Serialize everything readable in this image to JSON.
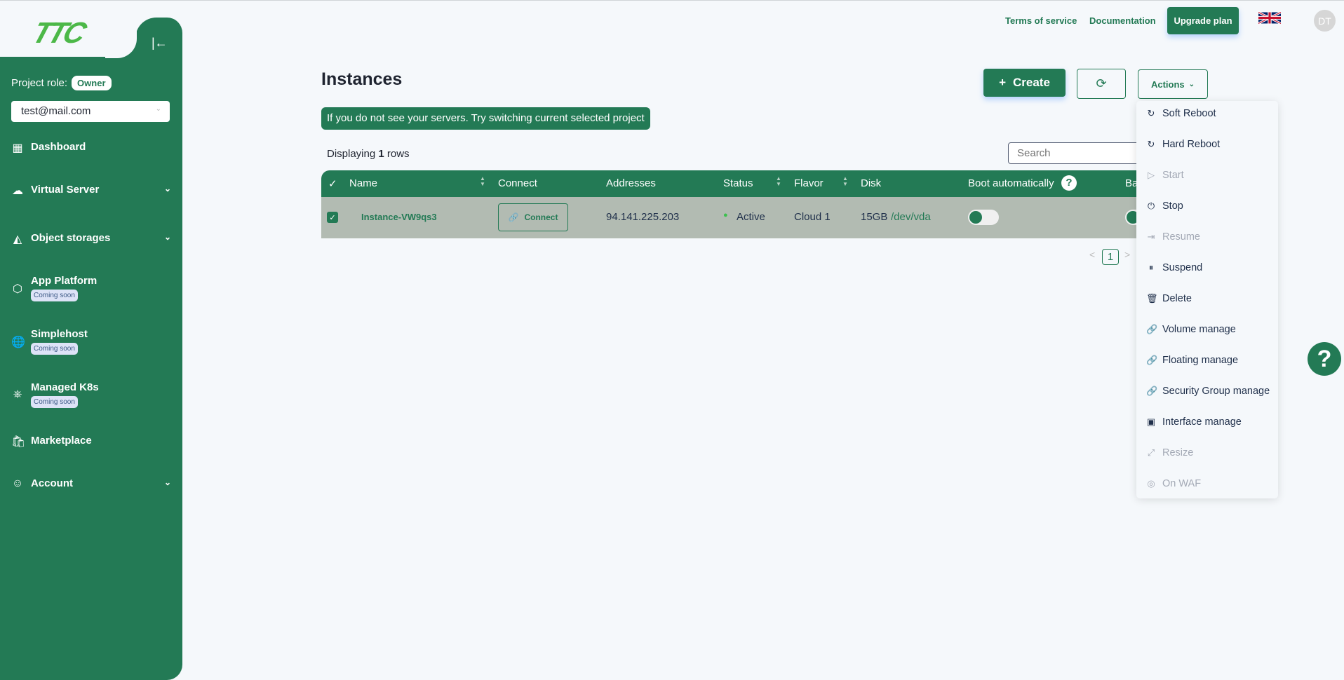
{
  "brand": {
    "logo": "TTC",
    "accent": "#237a55"
  },
  "sidebar": {
    "collapse_icon": "collapse-left-icon",
    "project_role_label": "Project role:",
    "project_role": "Owner",
    "project_select": "test@mail.com",
    "items": [
      {
        "label": "Dashboard",
        "icon": "grid-icon"
      },
      {
        "label": "Virtual Server",
        "icon": "cloud-icon",
        "expandable": true
      },
      {
        "label": "Object storages",
        "icon": "bucket-icon",
        "expandable": true
      },
      {
        "label": "App Platform",
        "icon": "cube-icon",
        "badge": "Coming soon"
      },
      {
        "label": "Simplehost",
        "icon": "globe-icon",
        "badge": "Coming soon"
      },
      {
        "label": "Managed K8s",
        "icon": "kubernetes-icon",
        "badge": "Coming soon"
      },
      {
        "label": "Marketplace",
        "icon": "bag-icon"
      },
      {
        "label": "Account",
        "icon": "user-circle-icon",
        "expandable": true
      }
    ]
  },
  "header": {
    "terms": "Terms of service",
    "docs": "Documentation",
    "upgrade": "Upgrade plan",
    "avatar": "DT",
    "language": "en-GB"
  },
  "main": {
    "title": "Instances",
    "create": "Create",
    "actions": "Actions",
    "notice": "If you do not see your servers. Try switching current selected project",
    "displaying_prefix": "Displaying",
    "displaying_count": "1",
    "displaying_suffix": "rows",
    "search_placeholder": "Search",
    "columns": [
      "Name",
      "Connect",
      "Addresses",
      "Status",
      "Flavor",
      "Disk",
      "Boot automatically",
      "Ba"
    ],
    "rows": [
      {
        "name": "Instance-VW9qs3",
        "connect": "Connect",
        "address": "94.141.225.203",
        "status": "Active",
        "flavor": "Cloud 1",
        "disk_size": "15GB",
        "disk_dev": "/dev/vda",
        "selected": true,
        "boot_auto": false
      }
    ],
    "page": "1"
  },
  "actions_menu": [
    {
      "label": "Soft Reboot",
      "icon": "reload-icon",
      "enabled": true
    },
    {
      "label": "Hard Reboot",
      "icon": "reload-icon",
      "enabled": true
    },
    {
      "label": "Start",
      "icon": "play-circle-icon",
      "enabled": false
    },
    {
      "label": "Stop",
      "icon": "power-icon",
      "enabled": true
    },
    {
      "label": "Resume",
      "icon": "resume-icon",
      "enabled": false
    },
    {
      "label": "Suspend",
      "icon": "pause-circle-icon",
      "enabled": true
    },
    {
      "label": "Delete",
      "icon": "trash-icon",
      "enabled": true
    },
    {
      "label": "Volume manage",
      "icon": "link-icon",
      "enabled": true
    },
    {
      "label": "Floating manage",
      "icon": "link-icon",
      "enabled": true
    },
    {
      "label": "Security Group manage",
      "icon": "link-icon",
      "enabled": true
    },
    {
      "label": "Interface manage",
      "icon": "interface-icon",
      "enabled": true
    },
    {
      "label": "Resize",
      "icon": "shrink-icon",
      "enabled": false
    },
    {
      "label": "On WAF",
      "icon": "shield-icon",
      "enabled": false
    }
  ]
}
